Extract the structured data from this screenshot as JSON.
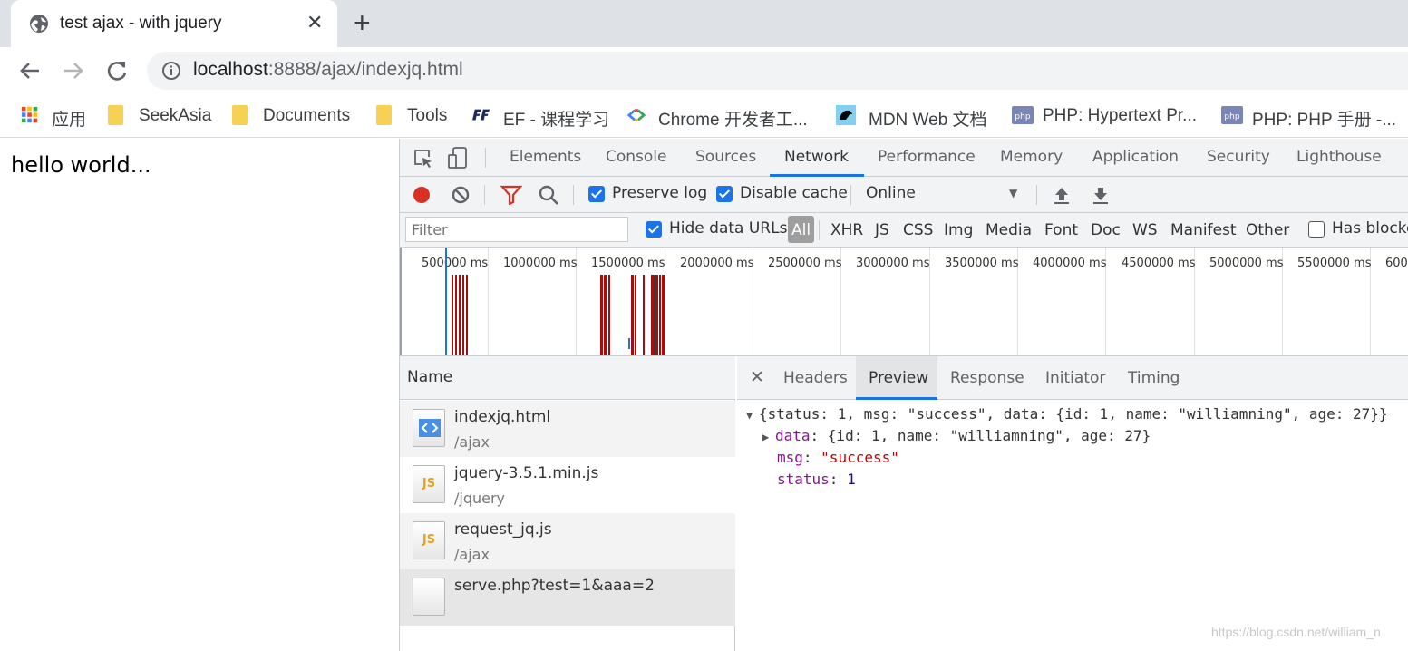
{
  "tab": {
    "title": "test ajax - with jquery",
    "close": "✕",
    "new_tab": "+"
  },
  "toolbar": {
    "url_host": "localhost",
    "url_rest": ":8888/ajax/indexjq.html"
  },
  "bookmarks": [
    {
      "label": "应用",
      "icon": "apps-grid-icon"
    },
    {
      "label": "SeekAsia",
      "icon": "folder-icon"
    },
    {
      "label": "Documents",
      "icon": "folder-icon"
    },
    {
      "label": "Tools",
      "icon": "folder-icon"
    },
    {
      "label": "EF - 课程学习",
      "icon": "ef-logo-icon"
    },
    {
      "label": "Chrome 开发者工...",
      "icon": "chrome-dev-icon"
    },
    {
      "label": "MDN Web 文档",
      "icon": "mdn-logo-icon"
    },
    {
      "label": "PHP: Hypertext Pr...",
      "icon": "php-logo-icon"
    },
    {
      "label": "PHP: PHP 手册 -...",
      "icon": "php-logo-icon"
    }
  ],
  "page": {
    "text": "hello world..."
  },
  "devtools": {
    "tabs": [
      "Elements",
      "Console",
      "Sources",
      "Network",
      "Performance",
      "Memory",
      "Application",
      "Security",
      "Lighthouse"
    ],
    "active_tab": "Network",
    "toolbar": {
      "preserve_log": "Preserve log",
      "disable_cache": "Disable cache",
      "throttle": "Online",
      "throttle_arrow": "▼"
    },
    "filter": {
      "placeholder": "Filter",
      "hide_data_urls": "Hide data URLs",
      "types": [
        "All",
        "XHR",
        "JS",
        "CSS",
        "Img",
        "Media",
        "Font",
        "Doc",
        "WS",
        "Manifest",
        "Other"
      ],
      "active_type": "All",
      "has_blocked": "Has blocke"
    },
    "overview": {
      "ticks": [
        "500000 ms",
        "1000000 ms",
        "1500000 ms",
        "2000000 ms",
        "2500000 ms",
        "3000000 ms",
        "3500000 ms",
        "4000000 ms",
        "4500000 ms",
        "5000000 ms",
        "5500000 ms",
        "6000"
      ]
    },
    "requests": {
      "header": "Name",
      "items": [
        {
          "name": "indexjq.html",
          "path": "/ajax",
          "type": "html"
        },
        {
          "name": "jquery-3.5.1.min.js",
          "path": "/jquery",
          "type": "js"
        },
        {
          "name": "request_jq.js",
          "path": "/ajax",
          "type": "js"
        },
        {
          "name": "serve.php?test=1&aaa=2",
          "path": "",
          "type": "other"
        }
      ]
    },
    "detail": {
      "close": "✕",
      "tabs": [
        "Headers",
        "Preview",
        "Response",
        "Initiator",
        "Timing"
      ],
      "active_tab": "Preview",
      "preview": {
        "summary": "{status: 1, msg: \"success\", data: {id: 1, name: \"williamning\", age: 27}}",
        "data_key": "data",
        "data_value": "{id: 1, name: \"williamning\", age: 27}",
        "msg_key": "msg",
        "msg_value": "\"success\"",
        "status_key": "status",
        "status_value": "1"
      }
    }
  },
  "watermark": "https://blog.csdn.net/william_n"
}
